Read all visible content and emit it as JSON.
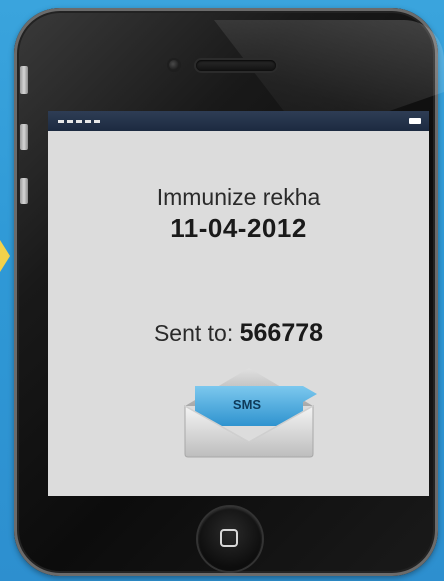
{
  "colors": {
    "background": "#3aa4dd",
    "phone_body": "#111111",
    "screen": "#dcdcdc",
    "status_bar": "#1c2a40",
    "envelope_blue": "#4fb3e6"
  },
  "status_bar": {
    "signal_icon": "signal-bars-icon",
    "battery_icon": "battery-icon"
  },
  "message": {
    "title": "Immunize rekha",
    "date": "11-04-2012",
    "sent_label": "Sent to:",
    "sent_number": "566778"
  },
  "sms_icon": {
    "label": "SMS",
    "icon": "sms-envelope-icon"
  },
  "home_button": {
    "icon": "home-square-icon"
  }
}
